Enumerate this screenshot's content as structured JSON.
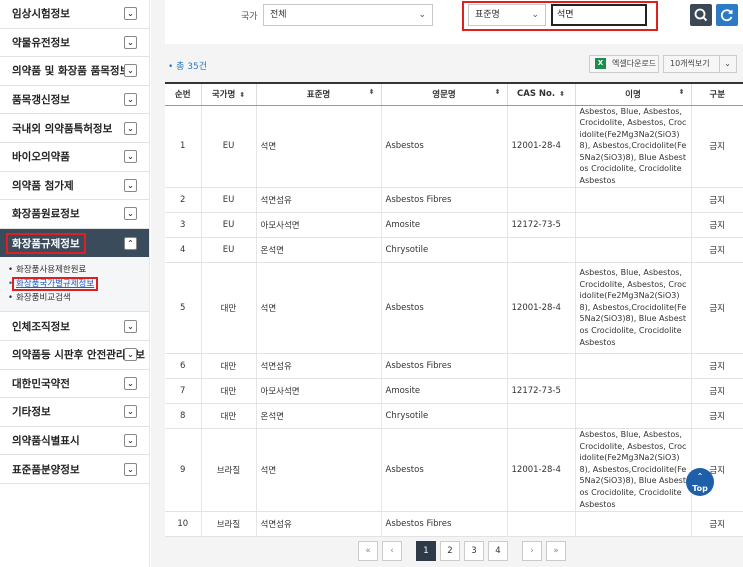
{
  "sidebar": {
    "items": [
      {
        "label": "임상시험정보"
      },
      {
        "label": "약물유전정보"
      },
      {
        "label": "의약품 및 화장품 품목정보"
      },
      {
        "label": "품목갱신정보"
      },
      {
        "label": "국내외 의약품특허정보"
      },
      {
        "label": "바이오의약품"
      },
      {
        "label": "의약품 첨가제"
      },
      {
        "label": "화장품원료정보"
      }
    ],
    "active": {
      "label": "화장품규제정보"
    },
    "submenu": [
      {
        "label": "화장품사용제한원료"
      },
      {
        "label": "화장품국가별규제정보"
      },
      {
        "label": "화장품비교검색"
      }
    ],
    "items_after": [
      {
        "label": "인체조직정보"
      },
      {
        "label": "의약품등 시판후 안전관리정보"
      },
      {
        "label": "대한민국약전"
      },
      {
        "label": "기타정보"
      },
      {
        "label": "의약품식별표시"
      },
      {
        "label": "표준품분양정보"
      }
    ]
  },
  "search": {
    "country_label": "국가",
    "country_value": "전체",
    "field_value": "표준명",
    "query_value": "석면",
    "search_icon": "magnifier-icon",
    "reset_icon": "refresh-icon"
  },
  "results": {
    "count_text": "• 총 35건",
    "excel_label": "엑셀다운로드",
    "rows_per_page": "10개씩보기",
    "columns": [
      "순번",
      "국가명",
      "표준명",
      "영문명",
      "CAS No.",
      "이명",
      "구분"
    ],
    "rows": [
      {
        "no": "1",
        "country": "EU",
        "std": "석면",
        "eng": "Asbestos",
        "cas": "12001-28-4",
        "alias": "Asbestos, Blue, Asbestos, Crocidolite, Asbestos, Crocidolite(Fe2Mg3Na2(SiO3)8), Asbestos,Crocidolite(Fe5Na2(SiO3)8), Blue Asbestos Crocidolite, Crocidolite Asbestos",
        "type": "금지"
      },
      {
        "no": "2",
        "country": "EU",
        "std": "석면섬유",
        "eng": "Asbestos Fibres",
        "cas": "",
        "alias": "",
        "type": "금지"
      },
      {
        "no": "3",
        "country": "EU",
        "std": "아모사석면",
        "eng": "Amosite",
        "cas": "12172-73-5",
        "alias": "",
        "type": "금지"
      },
      {
        "no": "4",
        "country": "EU",
        "std": "온석면",
        "eng": "Chrysotile",
        "cas": "",
        "alias": "",
        "type": "금지"
      },
      {
        "no": "5",
        "country": "대만",
        "std": "석면",
        "eng": "Asbestos",
        "cas": "12001-28-4",
        "alias": "Asbestos, Blue, Asbestos, Crocidolite, Asbestos, Crocidolite(Fe2Mg3Na2(SiO3)8), Asbestos,Crocidolite(Fe5Na2(SiO3)8), Blue Asbestos Crocidolite, Crocidolite Asbestos",
        "type": "금지"
      },
      {
        "no": "6",
        "country": "대만",
        "std": "석면섬유",
        "eng": "Asbestos Fibres",
        "cas": "",
        "alias": "",
        "type": "금지"
      },
      {
        "no": "7",
        "country": "대만",
        "std": "아모사석면",
        "eng": "Amosite",
        "cas": "12172-73-5",
        "alias": "",
        "type": "금지"
      },
      {
        "no": "8",
        "country": "대만",
        "std": "온석면",
        "eng": "Chrysotile",
        "cas": "",
        "alias": "",
        "type": "금지"
      },
      {
        "no": "9",
        "country": "브라질",
        "std": "석면",
        "eng": "Asbestos",
        "cas": "12001-28-4",
        "alias": "Asbestos, Blue, Asbestos, Crocidolite, Asbestos, Crocidolite(Fe2Mg3Na2(SiO3)8), Asbestos,Crocidolite(Fe5Na2(SiO3)8), Blue Asbestos Crocidolite, Crocidolite Asbestos",
        "type": "금지"
      },
      {
        "no": "10",
        "country": "브라질",
        "std": "석면섬유",
        "eng": "Asbestos Fibres",
        "cas": "",
        "alias": "",
        "type": "금지"
      }
    ]
  },
  "top_button": "Top",
  "pagination": {
    "first": "«",
    "prev": "‹",
    "pages": [
      "1",
      "2",
      "3",
      "4"
    ],
    "current": "1",
    "next": "›",
    "last": "»"
  },
  "colors": {
    "accent": "#2c7ac4",
    "active_menu": "#3a4b5c",
    "highlight": "#e02020",
    "link": "#2c8a7a"
  }
}
